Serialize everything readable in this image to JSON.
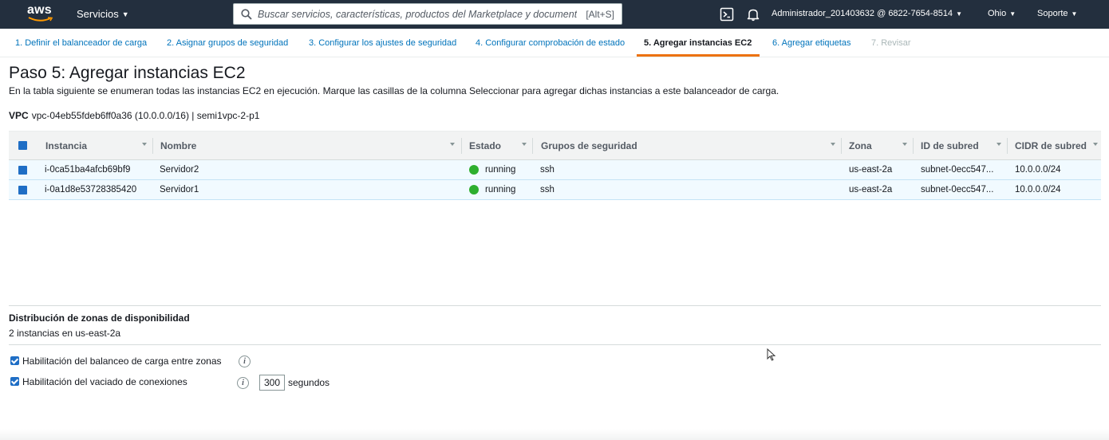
{
  "topnav": {
    "logo_text": "aws",
    "services_label": "Servicios",
    "search_placeholder": "Buscar servicios, características, productos del Marketplace y documentos",
    "search_shortcut": "[Alt+S]",
    "user_label": "Administrador_201403632 @ 6822-7654-8514",
    "region_label": "Ohio",
    "support_label": "Soporte",
    "bg_color": "#232f3e"
  },
  "wizard_tabs": [
    {
      "label": "1. Definir el balanceador de carga",
      "state": "link"
    },
    {
      "label": "2. Asignar grupos de seguridad",
      "state": "link"
    },
    {
      "label": "3. Configurar los ajustes de seguridad",
      "state": "link"
    },
    {
      "label": "4. Configurar comprobación de estado",
      "state": "link"
    },
    {
      "label": "5. Agregar instancias EC2",
      "state": "active"
    },
    {
      "label": "6. Agregar etiquetas",
      "state": "link"
    },
    {
      "label": "7. Revisar",
      "state": "disabled"
    }
  ],
  "page": {
    "title": "Paso 5: Agregar instancias EC2",
    "description": "En la tabla siguiente se enumeran todas las instancias EC2 en ejecución. Marque las casillas de la columna Seleccionar para agregar dichas instancias a este balanceador de carga.",
    "vpc_label": "VPC",
    "vpc_value": "vpc-04eb55fdeb6ff0a36 (10.0.0.0/16) | semi1vpc-2-p1"
  },
  "table": {
    "columns": [
      "Instancia",
      "Nombre",
      "Estado",
      "Grupos de seguridad",
      "Zona",
      "ID de subred",
      "CIDR de subred"
    ],
    "rows": [
      {
        "instance": "i-0ca51ba4afcb69bf9",
        "name": "Servidor2",
        "state": "running",
        "groups": "ssh",
        "zone": "us-east-2a",
        "subnet": "subnet-0ecc547...",
        "cidr": "10.0.0.0/24",
        "selected": true
      },
      {
        "instance": "i-0a1d8e53728385420",
        "name": "Servidor1",
        "state": "running",
        "groups": "ssh",
        "zone": "us-east-2a",
        "subnet": "subnet-0ecc547...",
        "cidr": "10.0.0.0/24",
        "selected": true
      }
    ]
  },
  "az_distribution": {
    "title": "Distribución de zonas de disponibilidad",
    "text": "2 instancias en us-east-2a"
  },
  "options": {
    "cross_zone_label": "Habilitación del balanceo de carga entre zonas",
    "cross_zone_checked": true,
    "draining_label": "Habilitación del vaciado de conexiones",
    "draining_checked": true,
    "draining_timeout": "300",
    "draining_unit": "segundos",
    "info_glyph": "i"
  },
  "colors": {
    "accent_orange": "#ec7211",
    "link_blue": "#0073bb",
    "running_green": "#2eaf2e",
    "selected_row": "#f1faff"
  }
}
